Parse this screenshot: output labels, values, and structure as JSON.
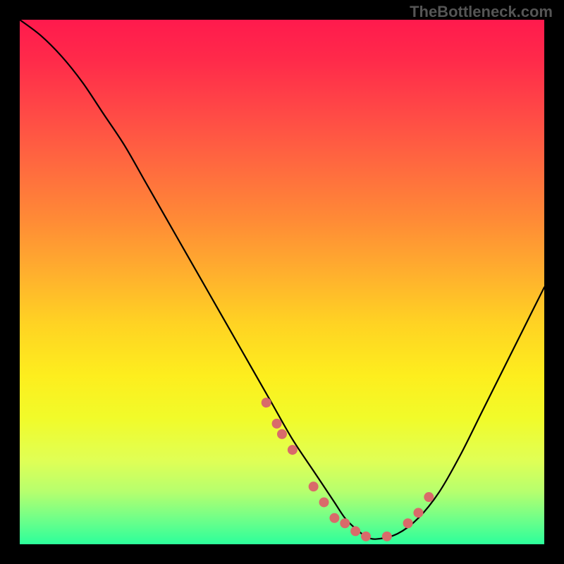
{
  "watermark": "TheBottleneck.com",
  "chart_data": {
    "type": "line",
    "title": "",
    "xlabel": "",
    "ylabel": "",
    "xlim": [
      0,
      100
    ],
    "ylim": [
      0,
      100
    ],
    "grid": false,
    "legend": false,
    "series": [
      {
        "name": "bottleneck-curve",
        "x": [
          0,
          4,
          8,
          12,
          16,
          20,
          24,
          28,
          32,
          36,
          40,
          44,
          48,
          52,
          56,
          58,
          60,
          62,
          64,
          66,
          68,
          72,
          76,
          80,
          84,
          88,
          92,
          96,
          100
        ],
        "y": [
          100,
          97,
          93,
          88,
          82,
          76,
          69,
          62,
          55,
          48,
          41,
          34,
          27,
          20,
          14,
          11,
          8,
          5,
          3,
          1.5,
          1,
          2,
          5,
          10,
          17,
          25,
          33,
          41,
          49
        ]
      }
    ],
    "points": {
      "name": "highlighted-points",
      "x": [
        47,
        49,
        50,
        52,
        56,
        58,
        60,
        62,
        64,
        66,
        70,
        74,
        76,
        78
      ],
      "y": [
        27,
        23,
        21,
        18,
        11,
        8,
        5,
        4,
        2.5,
        1.5,
        1.5,
        4,
        6,
        9
      ]
    },
    "background_gradient": {
      "top": "#ff1a4d",
      "bottom": "#2cff9b"
    }
  }
}
